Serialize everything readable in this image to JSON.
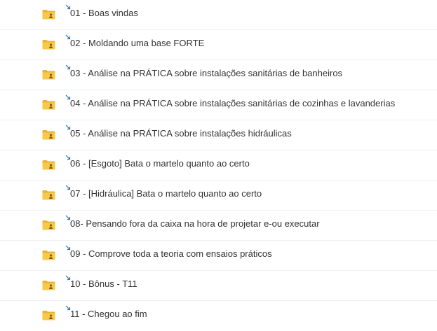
{
  "folders": [
    {
      "label": "01 - Boas vindas",
      "icon": "shared-folder-icon"
    },
    {
      "label": "02 - Moldando uma base FORTE",
      "icon": "shared-folder-icon"
    },
    {
      "label": "03 - Análise na PRÁTICA sobre instalações sanitárias de banheiros",
      "icon": "shared-folder-icon"
    },
    {
      "label": "04 - Análise na PRÁTICA sobre instalações sanitárias de cozinhas e lavanderias",
      "icon": "shared-folder-icon"
    },
    {
      "label": "05 - Análise na PRÁTICA sobre instalações hidráulicas",
      "icon": "shared-folder-icon"
    },
    {
      "label": "06 - [Esgoto] Bata o martelo quanto ao certo",
      "icon": "shared-folder-icon"
    },
    {
      "label": "07 - [Hidráulica] Bata o martelo quanto ao certo",
      "icon": "shared-folder-icon"
    },
    {
      "label": "08- Pensando fora da caixa na hora de projetar e-ou executar",
      "icon": "shared-folder-icon"
    },
    {
      "label": "09 - Comprove toda a teoria com ensaios práticos",
      "icon": "shared-folder-icon"
    },
    {
      "label": "10 - Bônus - T11",
      "icon": "shared-folder-icon"
    },
    {
      "label": "11 - Chegou ao fim",
      "icon": "shared-folder-icon"
    }
  ],
  "colors": {
    "folder": "#f7c948",
    "folder_tab": "#e9b23a",
    "person": "#8a5a12",
    "shortcut_arrow": "#2f6fb0",
    "divider": "#eef0f2"
  }
}
